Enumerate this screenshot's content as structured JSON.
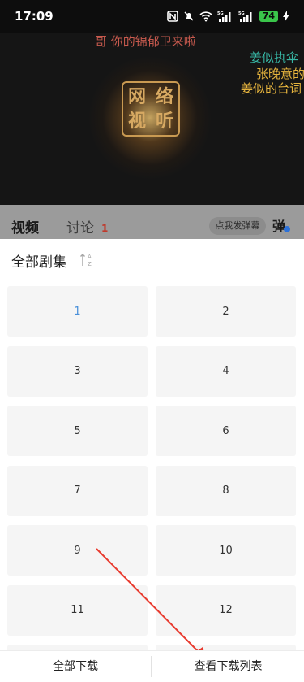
{
  "status_bar": {
    "time": "17:09",
    "nfc_icon": "nfc-icon",
    "dnd_icon": "mute-icon",
    "signal_label_1": "5G",
    "signal_label_2": "5G",
    "battery": "74",
    "charging_icon": "bolt-icon"
  },
  "video": {
    "watermark_chars": [
      "网",
      "络",
      "视",
      "听"
    ],
    "danmaku": [
      "哥 你的锦郁卫来啦",
      "姜似执伞",
      "张晚意的",
      "姜似的台词"
    ]
  },
  "tabs": {
    "video": "视频",
    "comments": "讨论",
    "comments_count": "1",
    "danmu_placeholder": "点我发弹幕",
    "danmu_toggle": "弹"
  },
  "sheet": {
    "title": "全部剧集",
    "sort_icon": "sort-az-icon",
    "sort_glyph": "A Z",
    "episodes": [
      "1",
      "2",
      "3",
      "4",
      "5",
      "6",
      "7",
      "8",
      "9",
      "10",
      "11",
      "12"
    ],
    "active_episode": "1"
  },
  "bottom": {
    "download_all": "全部下载",
    "view_download_list": "查看下载列表"
  },
  "colors": {
    "accent": "#4a90d9",
    "annotation": "#e83a2e",
    "comment_count": "#c0392b",
    "battery": "#3ac54a"
  }
}
